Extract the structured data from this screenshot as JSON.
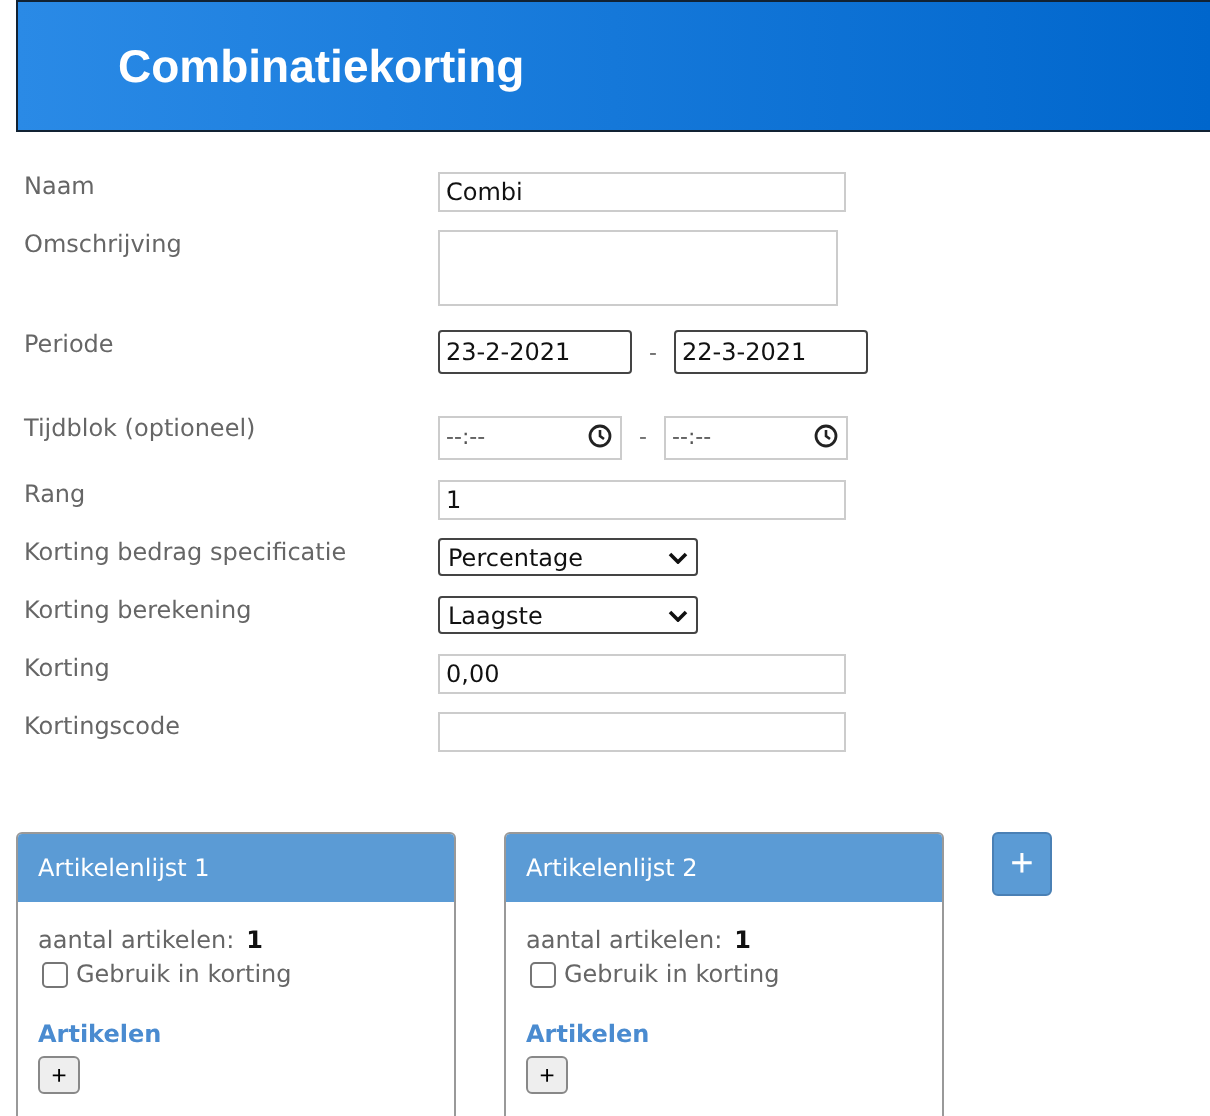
{
  "header": {
    "title": "Combinatiekorting"
  },
  "fields": [
    {
      "kind": "text",
      "label": "Naam",
      "value": "Combi"
    },
    {
      "kind": "textarea",
      "label": "Omschrijving"
    },
    {
      "kind": "daterange",
      "label": "Periode",
      "from": "23-2-2021",
      "separator": "-",
      "to": "22-3-2021"
    },
    {
      "kind": "timerange",
      "label": "Tijdblok (optioneel)",
      "from_placeholder": "--:--",
      "separator": "-",
      "to_placeholder": "--:--"
    },
    {
      "kind": "text",
      "label": "Rang",
      "value": "1"
    },
    {
      "kind": "select",
      "label": "Korting bedrag specificatie",
      "value": "Percentage"
    },
    {
      "kind": "select",
      "label": "Korting berekening",
      "value": "Laagste"
    },
    {
      "kind": "text",
      "label": "Korting",
      "value": "0,00"
    },
    {
      "kind": "text",
      "label": "Kortingscode"
    }
  ],
  "lists": [
    {
      "title": "Artikelenlijst 1",
      "count_label": "aantal artikelen:",
      "count": "1",
      "checkbox_label": "Gebruik in korting",
      "checked": false,
      "section": "Artikelen",
      "add": "+"
    },
    {
      "title": "Artikelenlijst 2",
      "count_label": "aantal artikelen:",
      "count": "1",
      "checkbox_label": "Gebruik in korting",
      "checked": false,
      "section": "Artikelen",
      "add": "+"
    }
  ],
  "add_list": "+"
}
